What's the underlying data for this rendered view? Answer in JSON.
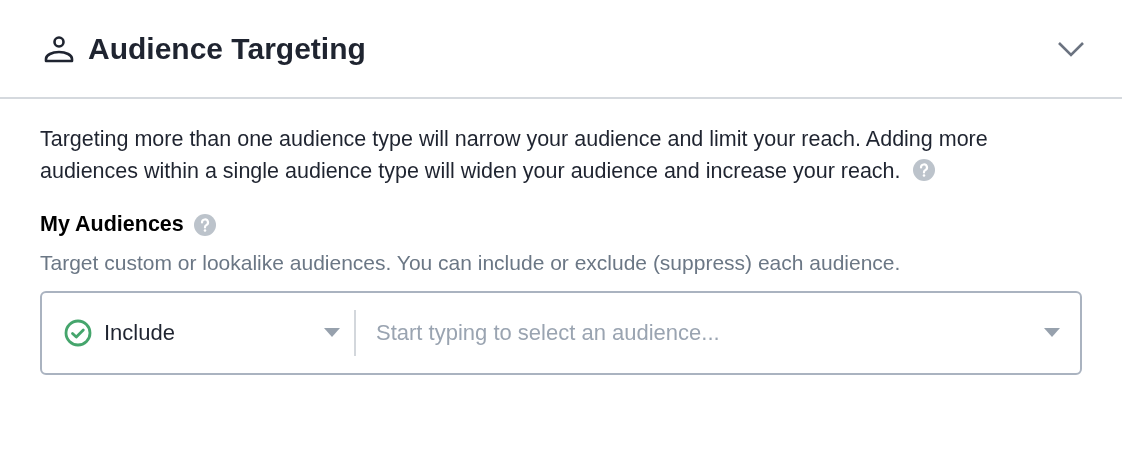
{
  "panel": {
    "title": "Audience Targeting",
    "expanded": true
  },
  "intro": "Targeting more than one audience type will narrow your audience and limit your reach. Adding more audiences within a single audience type will widen your audience and increase your reach.",
  "section": {
    "heading": "My Audiences",
    "description": "Target custom or lookalike audiences. You can include or exclude (suppress) each audience."
  },
  "audience_picker": {
    "mode": {
      "value": "Include",
      "kind": "include"
    },
    "search": {
      "placeholder": "Start typing to select an audience..."
    }
  }
}
